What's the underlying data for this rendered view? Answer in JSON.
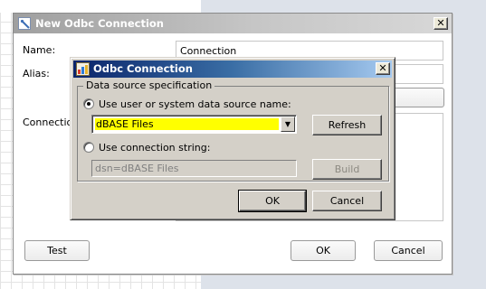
{
  "main_dialog": {
    "title": "New Odbc Connection",
    "close_glyph": "✕",
    "name_label": "Name:",
    "name_value": "Connection",
    "alias_label": "Alias:",
    "connection_label": "Connection",
    "test_button": "Test",
    "ok_button": "OK",
    "cancel_button": "Cancel"
  },
  "odbc_dialog": {
    "title": "Odbc Connection",
    "close_glyph": "✕",
    "group_label": "Data source specification",
    "option_dsn_label": "Use user or system data source name:",
    "option_dsn_selected": true,
    "dsn_selected_value": "dBASE Files",
    "dsn_highlight_color": "#ffff00",
    "dropdown_arrow": "▼",
    "refresh_button": "Refresh",
    "option_connstr_label": "Use connection string:",
    "connstr_value": "dsn=dBASE Files",
    "build_button": "Build",
    "ok_button": "OK",
    "cancel_button": "Cancel"
  },
  "colors": {
    "odbc_title_start": "#0a246a",
    "odbc_title_end": "#a6caf0",
    "dialog_face": "#d4d0c8",
    "background_right": "#dde2ea"
  }
}
